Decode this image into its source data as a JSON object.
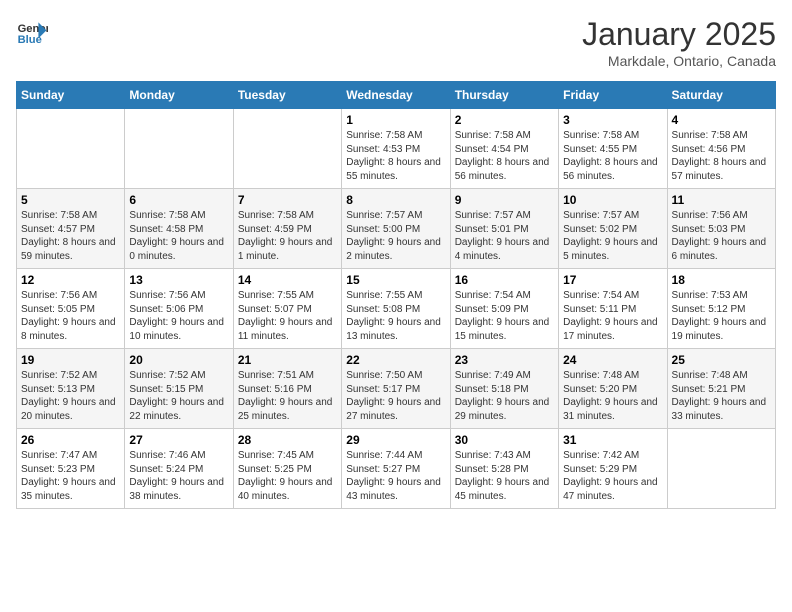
{
  "header": {
    "logo_line1": "General",
    "logo_line2": "Blue",
    "month": "January 2025",
    "location": "Markdale, Ontario, Canada"
  },
  "days_of_week": [
    "Sunday",
    "Monday",
    "Tuesday",
    "Wednesday",
    "Thursday",
    "Friday",
    "Saturday"
  ],
  "weeks": [
    [
      {
        "day": "",
        "content": ""
      },
      {
        "day": "",
        "content": ""
      },
      {
        "day": "",
        "content": ""
      },
      {
        "day": "1",
        "content": "Sunrise: 7:58 AM\nSunset: 4:53 PM\nDaylight: 8 hours\nand 55 minutes."
      },
      {
        "day": "2",
        "content": "Sunrise: 7:58 AM\nSunset: 4:54 PM\nDaylight: 8 hours\nand 56 minutes."
      },
      {
        "day": "3",
        "content": "Sunrise: 7:58 AM\nSunset: 4:55 PM\nDaylight: 8 hours\nand 56 minutes."
      },
      {
        "day": "4",
        "content": "Sunrise: 7:58 AM\nSunset: 4:56 PM\nDaylight: 8 hours\nand 57 minutes."
      }
    ],
    [
      {
        "day": "5",
        "content": "Sunrise: 7:58 AM\nSunset: 4:57 PM\nDaylight: 8 hours\nand 59 minutes."
      },
      {
        "day": "6",
        "content": "Sunrise: 7:58 AM\nSunset: 4:58 PM\nDaylight: 9 hours\nand 0 minutes."
      },
      {
        "day": "7",
        "content": "Sunrise: 7:58 AM\nSunset: 4:59 PM\nDaylight: 9 hours\nand 1 minute."
      },
      {
        "day": "8",
        "content": "Sunrise: 7:57 AM\nSunset: 5:00 PM\nDaylight: 9 hours\nand 2 minutes."
      },
      {
        "day": "9",
        "content": "Sunrise: 7:57 AM\nSunset: 5:01 PM\nDaylight: 9 hours\nand 4 minutes."
      },
      {
        "day": "10",
        "content": "Sunrise: 7:57 AM\nSunset: 5:02 PM\nDaylight: 9 hours\nand 5 minutes."
      },
      {
        "day": "11",
        "content": "Sunrise: 7:56 AM\nSunset: 5:03 PM\nDaylight: 9 hours\nand 6 minutes."
      }
    ],
    [
      {
        "day": "12",
        "content": "Sunrise: 7:56 AM\nSunset: 5:05 PM\nDaylight: 9 hours\nand 8 minutes."
      },
      {
        "day": "13",
        "content": "Sunrise: 7:56 AM\nSunset: 5:06 PM\nDaylight: 9 hours\nand 10 minutes."
      },
      {
        "day": "14",
        "content": "Sunrise: 7:55 AM\nSunset: 5:07 PM\nDaylight: 9 hours\nand 11 minutes."
      },
      {
        "day": "15",
        "content": "Sunrise: 7:55 AM\nSunset: 5:08 PM\nDaylight: 9 hours\nand 13 minutes."
      },
      {
        "day": "16",
        "content": "Sunrise: 7:54 AM\nSunset: 5:09 PM\nDaylight: 9 hours\nand 15 minutes."
      },
      {
        "day": "17",
        "content": "Sunrise: 7:54 AM\nSunset: 5:11 PM\nDaylight: 9 hours\nand 17 minutes."
      },
      {
        "day": "18",
        "content": "Sunrise: 7:53 AM\nSunset: 5:12 PM\nDaylight: 9 hours\nand 19 minutes."
      }
    ],
    [
      {
        "day": "19",
        "content": "Sunrise: 7:52 AM\nSunset: 5:13 PM\nDaylight: 9 hours\nand 20 minutes."
      },
      {
        "day": "20",
        "content": "Sunrise: 7:52 AM\nSunset: 5:15 PM\nDaylight: 9 hours\nand 22 minutes."
      },
      {
        "day": "21",
        "content": "Sunrise: 7:51 AM\nSunset: 5:16 PM\nDaylight: 9 hours\nand 25 minutes."
      },
      {
        "day": "22",
        "content": "Sunrise: 7:50 AM\nSunset: 5:17 PM\nDaylight: 9 hours\nand 27 minutes."
      },
      {
        "day": "23",
        "content": "Sunrise: 7:49 AM\nSunset: 5:18 PM\nDaylight: 9 hours\nand 29 minutes."
      },
      {
        "day": "24",
        "content": "Sunrise: 7:48 AM\nSunset: 5:20 PM\nDaylight: 9 hours\nand 31 minutes."
      },
      {
        "day": "25",
        "content": "Sunrise: 7:48 AM\nSunset: 5:21 PM\nDaylight: 9 hours\nand 33 minutes."
      }
    ],
    [
      {
        "day": "26",
        "content": "Sunrise: 7:47 AM\nSunset: 5:23 PM\nDaylight: 9 hours\nand 35 minutes."
      },
      {
        "day": "27",
        "content": "Sunrise: 7:46 AM\nSunset: 5:24 PM\nDaylight: 9 hours\nand 38 minutes."
      },
      {
        "day": "28",
        "content": "Sunrise: 7:45 AM\nSunset: 5:25 PM\nDaylight: 9 hours\nand 40 minutes."
      },
      {
        "day": "29",
        "content": "Sunrise: 7:44 AM\nSunset: 5:27 PM\nDaylight: 9 hours\nand 43 minutes."
      },
      {
        "day": "30",
        "content": "Sunrise: 7:43 AM\nSunset: 5:28 PM\nDaylight: 9 hours\nand 45 minutes."
      },
      {
        "day": "31",
        "content": "Sunrise: 7:42 AM\nSunset: 5:29 PM\nDaylight: 9 hours\nand 47 minutes."
      },
      {
        "day": "",
        "content": ""
      }
    ]
  ]
}
